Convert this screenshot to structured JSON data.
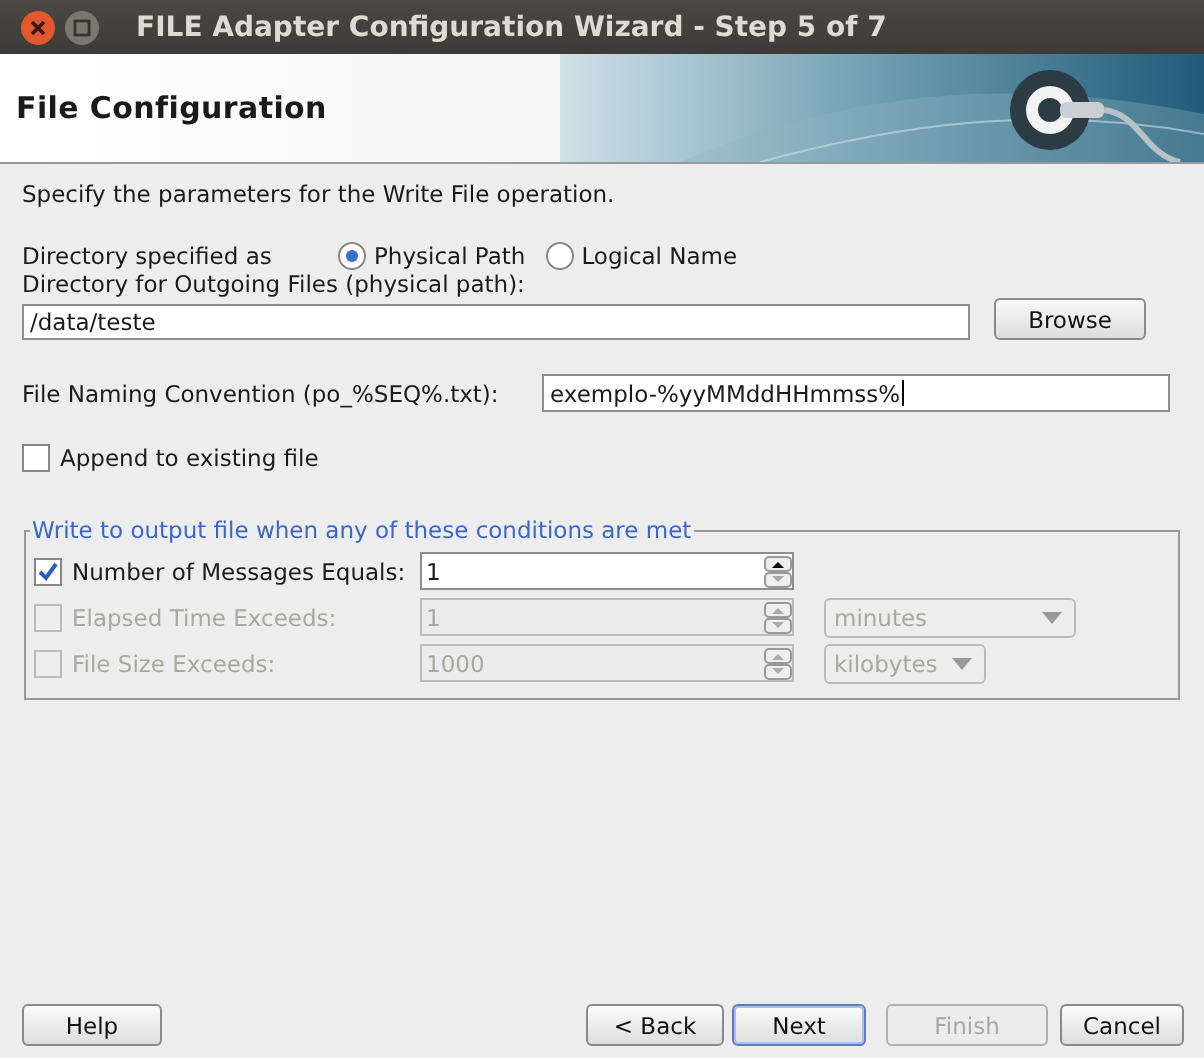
{
  "window": {
    "title": "FILE Adapter Configuration Wizard - Step 5 of 7"
  },
  "header": {
    "title": "File Configuration"
  },
  "intro": "Specify the parameters for the Write File operation.",
  "directory_type": {
    "label": "Directory specified as",
    "options": [
      {
        "label": "Physical Path",
        "selected": true
      },
      {
        "label": "Logical Name",
        "selected": false
      }
    ]
  },
  "directory": {
    "label": "Directory for Outgoing Files (physical path):",
    "value": "/data/teste",
    "button": "Browse"
  },
  "naming": {
    "label": "File Naming Convention (po_%SEQ%.txt):",
    "value": "exemplo-%yyMMddHHmmss%"
  },
  "append": {
    "label": "Append to existing file",
    "checked": false
  },
  "conditions": {
    "title": "Write to output file when any of these conditions are met",
    "rows": [
      {
        "label": "Number of Messages Equals:",
        "checked": true,
        "disabled": false,
        "value": "1"
      },
      {
        "label": "Elapsed Time Exceeds:",
        "checked": false,
        "disabled": true,
        "value": "1",
        "unit": "minutes"
      },
      {
        "label": "File Size Exceeds:",
        "checked": false,
        "disabled": true,
        "value": "1000",
        "unit": "kilobytes"
      }
    ]
  },
  "buttons": [
    {
      "label": "Help",
      "disabled": false,
      "focused": false
    },
    {
      "label": "< Back",
      "disabled": false,
      "focused": false
    },
    {
      "label": "Next",
      "disabled": false,
      "focused": true
    },
    {
      "label": "Finish",
      "disabled": true,
      "focused": false
    },
    {
      "label": "Cancel",
      "disabled": false,
      "focused": false
    }
  ]
}
